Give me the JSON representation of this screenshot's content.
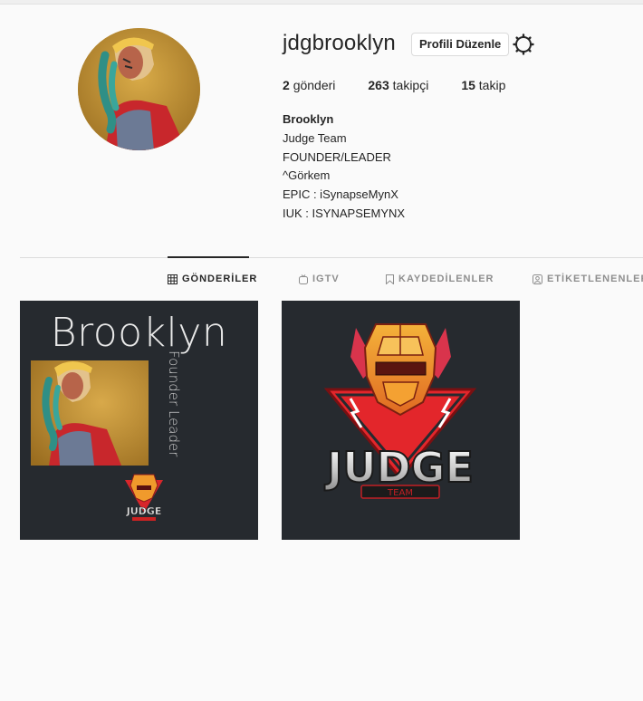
{
  "profile": {
    "username": "jdgbrooklyn",
    "edit_button": "Profili Düzenle",
    "stats": {
      "posts_count": "2",
      "posts_label": "gönderi",
      "followers_count": "263",
      "followers_label": "takipçi",
      "following_count": "15",
      "following_label": "takip"
    },
    "bio": {
      "name": "Brooklyn",
      "lines": [
        "Judge Team",
        "FOUNDER/LEADER",
        "^Görkem",
        "EPIC : iSynapseMynX",
        "IUK : ISYNAPSEMYNX"
      ]
    }
  },
  "tabs": [
    {
      "label": "GÖNDERİLER",
      "icon": "grid-icon",
      "active": true
    },
    {
      "label": "IGTV",
      "icon": "igtv-icon",
      "active": false
    },
    {
      "label": "KAYDEDİLENLER",
      "icon": "bookmark-icon",
      "active": false
    },
    {
      "label": "ETİKETLENENLER",
      "icon": "tag-icon",
      "active": false
    }
  ],
  "posts": [
    {
      "title": "Brooklyn",
      "side_text": "Founder Leader",
      "logo_text": "JUDGE"
    },
    {
      "logo_text": "JUDGE",
      "logo_sub": "TEAM"
    }
  ],
  "colors": {
    "background": "#fafafa",
    "text": "#262626",
    "muted": "#8e8e8e",
    "post_bg": "#262a2f",
    "logo_red": "#e3262b",
    "logo_gold": "#f1a230"
  }
}
